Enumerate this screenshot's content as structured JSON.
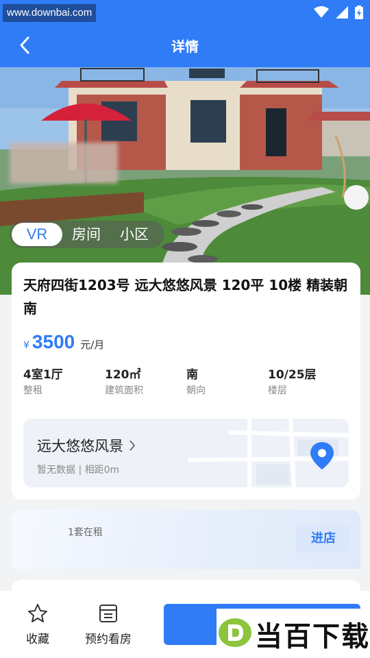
{
  "status_bar": {
    "watermark": "www.downbai.com",
    "icons": [
      "wifi-icon",
      "signal-icon",
      "battery-icon"
    ]
  },
  "nav": {
    "back_icon": "chevron-left-icon",
    "title": "详情"
  },
  "hero": {
    "tabs": [
      {
        "label": "VR",
        "active": true
      },
      {
        "label": "房间",
        "active": false
      },
      {
        "label": "小区",
        "active": false
      }
    ]
  },
  "listing": {
    "title": "天府四街1203号 远大悠悠风景 120平 10楼 精装朝南",
    "price_symbol": "¥",
    "price": "3500",
    "price_unit": "元/月",
    "specs": [
      {
        "value": "4室1厅",
        "label": "整租"
      },
      {
        "value": "120㎡",
        "label": "建筑面积"
      },
      {
        "value": "南",
        "label": "朝向"
      },
      {
        "value": "10/25层",
        "label": "楼层"
      }
    ],
    "community": {
      "name": "远大悠悠风景",
      "subtitle": "暂无数据 | 相距0m",
      "chevron_icon": "chevron-right-icon",
      "pin_icon": "location-pin-icon"
    }
  },
  "agent": {
    "subtitle": "1套在租",
    "shop_button": "进店"
  },
  "bottom_bar": {
    "favorite_label": "收藏",
    "favorite_icon": "star-icon",
    "appointment_label": "预约看房",
    "appointment_icon": "calendar-list-icon",
    "logo_text": "当百下载"
  },
  "colors": {
    "primary": "#2f7cf6",
    "background": "#f2f3f5"
  }
}
